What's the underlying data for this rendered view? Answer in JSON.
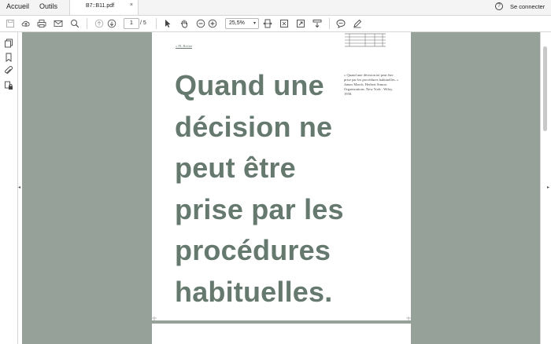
{
  "menu": {
    "home": "Accueil",
    "tools": "Outils"
  },
  "tab": {
    "title": "B7::B11.pdf",
    "close": "×"
  },
  "account": {
    "help": "?",
    "sign_in": "Se connecter"
  },
  "toolbar": {
    "current_page": "1",
    "total_pages": "/ 5",
    "zoom": "25,5%",
    "zoom_caret": "▾"
  },
  "sidepanel": {
    "collapse_left": "◂",
    "collapse_right": "▸"
  },
  "page": {
    "link_text": "« PL Revue",
    "quote": "Quand une décision ne peut être prise par les procédures habituelles.",
    "side_note": "« Quand une décision ne peut être prise par les procédures habituelles. » James March, Herbert Simon. Organizations. New York : Wiley, 1958."
  },
  "colors": {
    "canvas": "#95a199",
    "quote_text": "#66796f"
  },
  "icons": [
    "save-icon",
    "upload-icon",
    "print-icon",
    "email-icon",
    "search-icon",
    "page-up-icon",
    "page-down-icon",
    "select-arrow-icon",
    "hand-icon",
    "zoom-out-icon",
    "zoom-in-icon",
    "fit-width-icon",
    "fit-page-icon",
    "fullscreen-icon",
    "scroll-mode-icon",
    "comment-icon",
    "pen-icon"
  ]
}
